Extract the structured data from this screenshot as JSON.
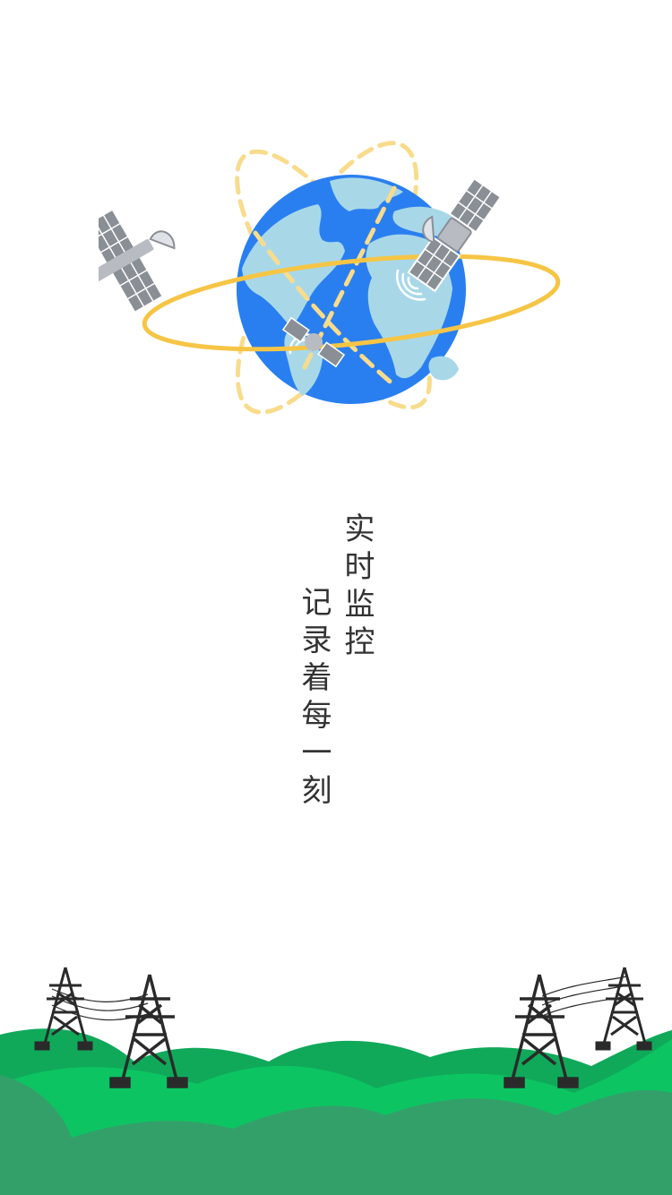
{
  "slogan": {
    "line1": "实时监控",
    "line2": "记录着每一刻"
  },
  "colors": {
    "ocean": "#2a7ff0",
    "land": "#a8d8e8",
    "orbit_solid": "#f6c545",
    "orbit_dashed": "#f8dc8c",
    "satellite_panel": "#8a8f96",
    "hill_dark": "#33a06a",
    "hill_light": "#0cc562",
    "hill_mid": "#10a95a",
    "tower": "#2a2a2a",
    "text": "#333333"
  },
  "icons": [
    "globe-icon",
    "satellite-icon",
    "power-tower-icon"
  ]
}
